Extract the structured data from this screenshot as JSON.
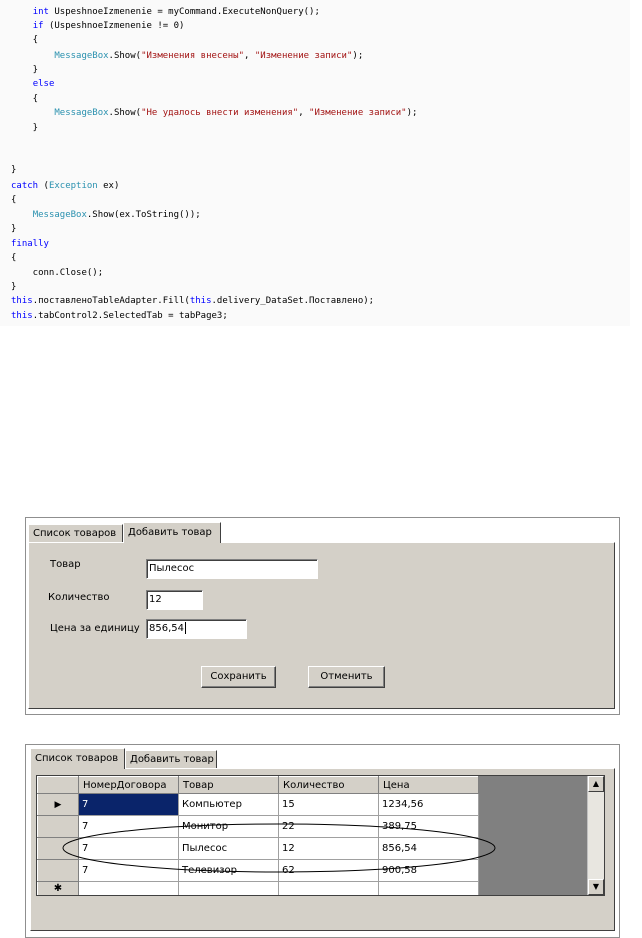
{
  "code": {
    "lines": [
      [
        {
          "t": "    "
        },
        {
          "t": "int",
          "c": "kw"
        },
        {
          "t": " UspeshnoeIzmenenie = myCommand.ExecuteNonQuery();"
        }
      ],
      [
        {
          "t": "    "
        },
        {
          "t": "if",
          "c": "kw"
        },
        {
          "t": " (UspeshnoeIzmenenie != 0)"
        }
      ],
      [
        {
          "t": "    {"
        }
      ],
      [
        {
          "t": "        "
        },
        {
          "t": "MessageBox",
          "c": "ty"
        },
        {
          "t": ".Show("
        },
        {
          "t": "\"Изменения внесены\"",
          "c": "st"
        },
        {
          "t": ", "
        },
        {
          "t": "\"Изменение записи\"",
          "c": "st"
        },
        {
          "t": ");"
        }
      ],
      [
        {
          "t": "    }"
        }
      ],
      [
        {
          "t": "    "
        },
        {
          "t": "else",
          "c": "kw"
        }
      ],
      [
        {
          "t": "    {"
        }
      ],
      [
        {
          "t": "        "
        },
        {
          "t": "MessageBox",
          "c": "ty"
        },
        {
          "t": ".Show("
        },
        {
          "t": "\"Не удалось внести изменения\"",
          "c": "st"
        },
        {
          "t": ", "
        },
        {
          "t": "\"Изменение записи\"",
          "c": "st"
        },
        {
          "t": ");"
        }
      ],
      [
        {
          "t": "    }"
        }
      ],
      [],
      [],
      [
        {
          "t": "}"
        }
      ],
      [
        {
          "t": "catch",
          "c": "kw"
        },
        {
          "t": " ("
        },
        {
          "t": "Exception",
          "c": "ty"
        },
        {
          "t": " ex)"
        }
      ],
      [
        {
          "t": "{"
        }
      ],
      [
        {
          "t": "    "
        },
        {
          "t": "MessageBox",
          "c": "ty"
        },
        {
          "t": ".Show(ex.ToString());"
        }
      ],
      [
        {
          "t": "}"
        }
      ],
      [
        {
          "t": "finally",
          "c": "kw"
        }
      ],
      [
        {
          "t": "{"
        }
      ],
      [
        {
          "t": "    conn.Close();"
        }
      ],
      [
        {
          "t": "}"
        }
      ],
      [
        {
          "t": "this",
          "c": "kw"
        },
        {
          "t": ".поставленоTableAdapter.Fill("
        },
        {
          "t": "this",
          "c": "kw"
        },
        {
          "t": ".delivery_DataSet.Поставлено);"
        }
      ],
      [
        {
          "t": "this",
          "c": "kw"
        },
        {
          "t": ".tabControl2.SelectedTab = tabPage3;"
        }
      ]
    ]
  },
  "form_add": {
    "tabs": [
      "Список товаров",
      "Добавить товар"
    ],
    "active_tab": 1,
    "fields": {
      "tovar": {
        "label": "Товар",
        "value": "Пылесос"
      },
      "kolichestvo": {
        "label": "Количество",
        "value": "12"
      },
      "cena": {
        "label": "Цена за единицу",
        "value": "856,54"
      }
    },
    "save_label": "Сохранить",
    "cancel_label": "Отменить"
  },
  "form_list": {
    "tabs": [
      "Список товаров",
      "Добавить товар"
    ],
    "active_tab": 0,
    "columns": [
      "НомерДоговора",
      "Товар",
      "Количество",
      "Цена"
    ],
    "rows": [
      [
        "7",
        "Компьютер",
        "15",
        "1234,56"
      ],
      [
        "7",
        "Монитор",
        "22",
        "389,75"
      ],
      [
        "7",
        "Пылесос",
        "12",
        "856,54"
      ],
      [
        "7",
        "Телевизор",
        "62",
        "900,58"
      ]
    ],
    "current_row_marker": "▶",
    "new_row_marker": "✱",
    "highlighted_row": 2
  }
}
